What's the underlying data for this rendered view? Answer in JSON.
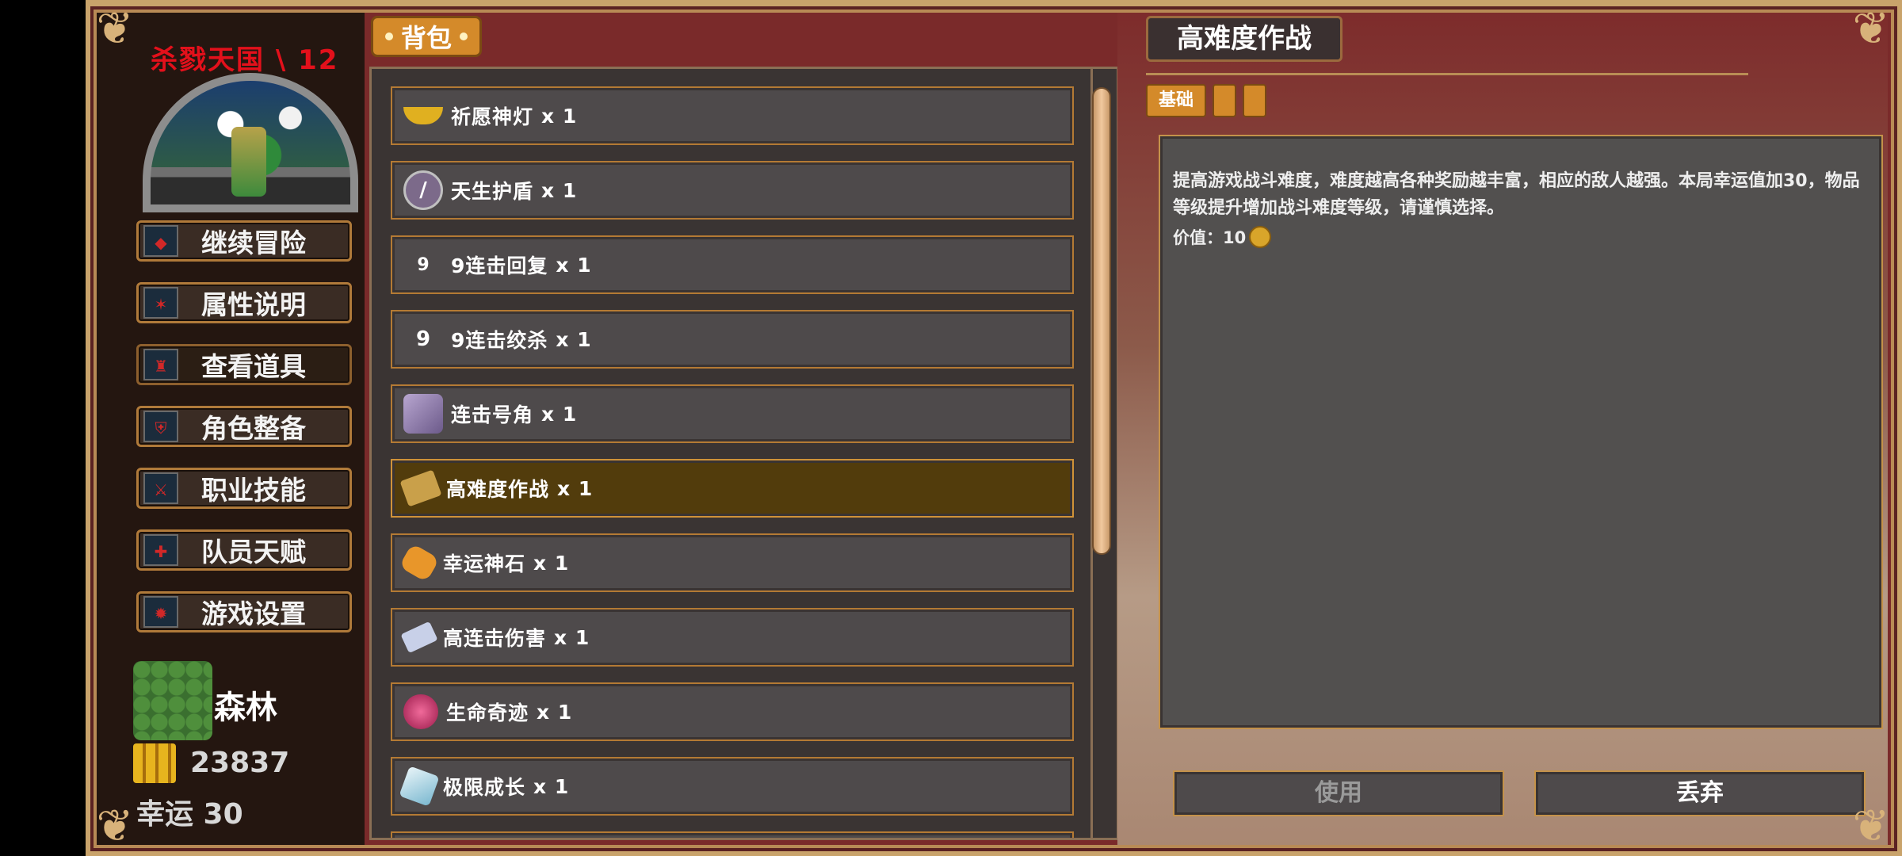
{
  "sidebar": {
    "game_title": "杀戮天国 \\ 12",
    "menu": [
      {
        "label": "继续冒险",
        "icon": "map-icon"
      },
      {
        "label": "属性说明",
        "icon": "attribute-icon"
      },
      {
        "label": "查看道具",
        "icon": "item-icon"
      },
      {
        "label": "角色整备",
        "icon": "equipment-icon"
      },
      {
        "label": "职业技能",
        "icon": "skill-icon"
      },
      {
        "label": "队员天赋",
        "icon": "talent-icon"
      },
      {
        "label": "游戏设置",
        "icon": "settings-icon"
      }
    ],
    "active_menu": "查看道具",
    "location": "森林",
    "gold": "23837",
    "luck": "幸运 30"
  },
  "backpack": {
    "tab_label": "背包",
    "items": [
      {
        "name": "祈愿神灯",
        "count": "x 1",
        "icon": "lamp-icon",
        "icon_color": "#e0b020"
      },
      {
        "name": "天生护盾",
        "count": "x 1",
        "icon": "shield-orb-icon",
        "icon_color": "#7c6a8a"
      },
      {
        "name": "9连击回复",
        "count": "x 1",
        "icon": "nine-icon",
        "icon_color": "#4e4a4b"
      },
      {
        "name": "9连击绞杀",
        "count": "x 1",
        "icon": "nine-icon",
        "icon_color": "#4e4a4b"
      },
      {
        "name": "连击号角",
        "count": "x 1",
        "icon": "horn-icon",
        "icon_color": "#8e7aa6"
      },
      {
        "name": "高难度作战",
        "count": "x 1",
        "icon": "scroll-icon",
        "icon_color": "#c9a04a"
      },
      {
        "name": "幸运神石",
        "count": "x 1",
        "icon": "luck-stone-icon",
        "icon_color": "#e8962a"
      },
      {
        "name": "高连击伤害",
        "count": "x 1",
        "icon": "paper-icon",
        "icon_color": "#c8d0e8"
      },
      {
        "name": "生命奇迹",
        "count": "x 1",
        "icon": "life-orb-icon",
        "icon_color": "#c02a5a"
      },
      {
        "name": "极限成长",
        "count": "x 1",
        "icon": "crystal-icon",
        "icon_color": "#a8d8e8"
      }
    ],
    "selected_item": "高难度作战"
  },
  "detail": {
    "title": "高难度作战",
    "category": "基础",
    "description": "提高游戏战斗难度，难度越高各种奖励越丰富，相应的敌人越强。本局幸运值加30，物品等级提升增加战斗难度等级，请谨慎选择。",
    "value_label": "价值：10",
    "use_label": "使用",
    "discard_label": "丢弃"
  },
  "colors": {
    "title_red": "#e3101b",
    "accent_orange": "#d48a2a",
    "disabled_text": "#9a9a9a"
  }
}
